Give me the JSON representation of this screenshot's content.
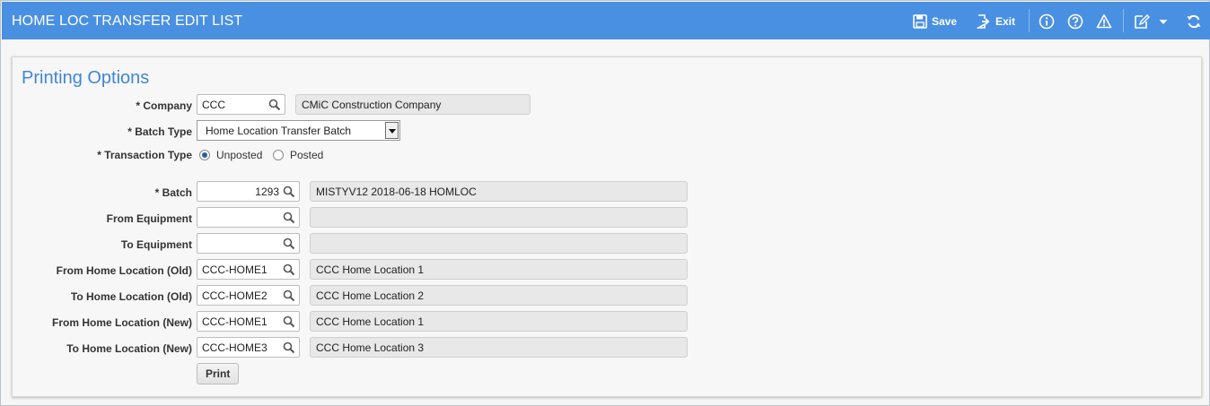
{
  "header": {
    "title": "HOME LOC TRANSFER EDIT LIST",
    "save_label": "Save",
    "exit_label": "Exit",
    "icons": [
      "save-icon",
      "exit-icon",
      "info-icon",
      "help-icon",
      "warning-icon",
      "edit-icon",
      "chevron-down-icon",
      "refresh-icon"
    ]
  },
  "panel": {
    "title": "Printing Options",
    "company": {
      "label": "* Company",
      "value": "CCC",
      "description": "CMiC Construction Company"
    },
    "batch_type": {
      "label": "* Batch Type",
      "value": "Home Location Transfer Batch"
    },
    "transaction_type": {
      "label": "* Transaction Type",
      "options": [
        "Unposted",
        "Posted"
      ],
      "selected": "Unposted"
    },
    "fields": [
      {
        "label": "* Batch",
        "value": "1293",
        "description": "MISTYV12 2018-06-18 HOMLOC"
      },
      {
        "label": "From Equipment",
        "value": "",
        "description": ""
      },
      {
        "label": "To Equipment",
        "value": "",
        "description": ""
      },
      {
        "label": "From Home Location (Old)",
        "value": "CCC-HOME1",
        "description": "CCC Home Location 1"
      },
      {
        "label": "To Home Location (Old)",
        "value": "CCC-HOME2",
        "description": "CCC Home Location 2"
      },
      {
        "label": "From Home Location (New)",
        "value": "CCC-HOME1",
        "description": "CCC Home Location 1"
      },
      {
        "label": "To Home Location (New)",
        "value": "CCC-HOME3",
        "description": "CCC Home Location 3"
      }
    ],
    "print_label": "Print"
  },
  "colors": {
    "header_bg": "#4a90e2",
    "panel_title": "#3f86d6"
  }
}
